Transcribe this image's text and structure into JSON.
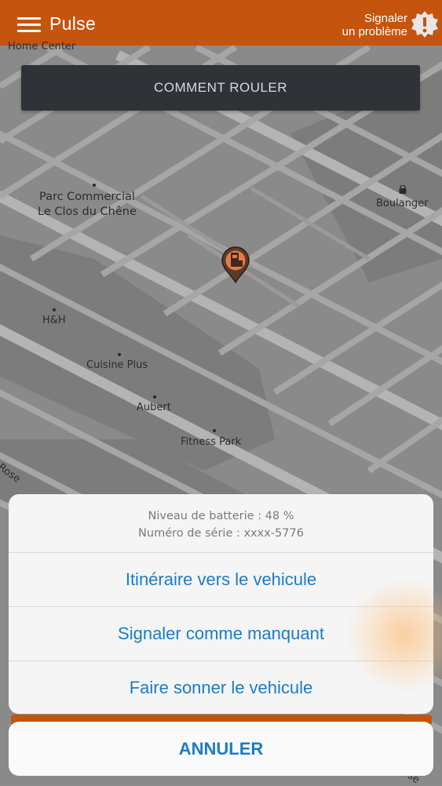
{
  "header": {
    "app_title": "Pulse",
    "report_line1": "Signaler",
    "report_line2": "un problème"
  },
  "map": {
    "how_to_ride": "COMMENT ROULER",
    "places": {
      "home_center": "Home Center",
      "parc_line1": "Parc Commercial",
      "parc_line2": "Le Clos du Chêne",
      "boulanger": "Boulanger",
      "hm": "H&H",
      "cuisine_plus": "Cuisine Plus",
      "aubert": "Aubert",
      "fitness_park": "Fitness Park",
      "rose": "Rose",
      "rose_bottom": "ose"
    }
  },
  "sheet": {
    "battery": "Niveau de batterie : 48 %",
    "serial": "Numéro de série : xxxx-5776",
    "actions": [
      "Itinéraire vers le vehicule",
      "Signaler comme manquant",
      "Faire sonner le vehicule"
    ],
    "cancel": "ANNULER"
  },
  "colors": {
    "brand_orange": "#c4540e",
    "action_blue": "#1b7cc8",
    "map_gray": "#8c8c8c"
  }
}
